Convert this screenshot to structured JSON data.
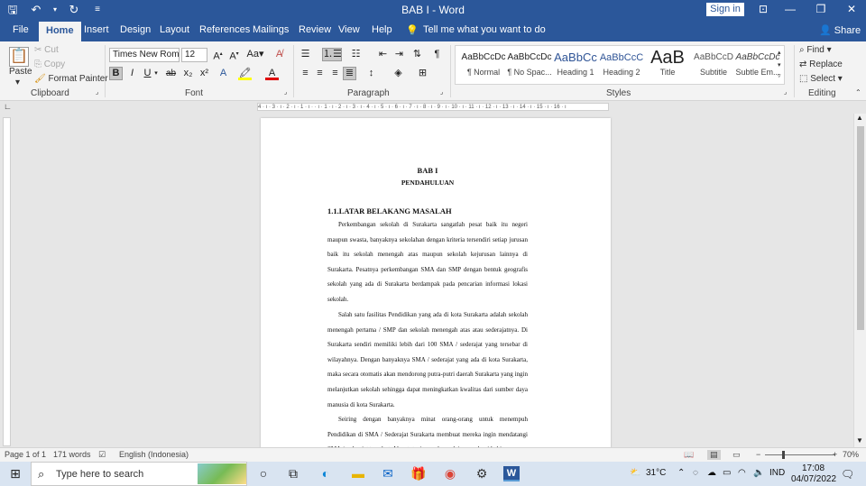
{
  "titlebar": {
    "title": "BAB I  -  Word",
    "sign_in": "Sign in",
    "icons": [
      "save-icon",
      "undo-icon",
      "redo-icon",
      "customize-icon",
      "ribbon-display-icon",
      "minimize-icon",
      "restore-icon",
      "close-icon"
    ],
    "bg_color": "#2b579a"
  },
  "tabs": [
    "File",
    "Home",
    "Insert",
    "Design",
    "Layout",
    "References",
    "Mailings",
    "Review",
    "View",
    "Help",
    "Tell me what you want to do",
    "Share"
  ],
  "clipboard": {
    "paste": "Paste",
    "cut": "Cut",
    "copy": "Copy",
    "format_painter": "Format Painter",
    "label": "Clipboard"
  },
  "font": {
    "name": "Times New Roma",
    "size": "12",
    "label": "Font",
    "bold": "B",
    "italic": "I",
    "underline": "U",
    "strike": "ab",
    "sub": "x₂",
    "sup": "x²"
  },
  "paragraph": {
    "label": "Paragraph"
  },
  "styles": {
    "label": "Styles",
    "items": [
      {
        "preview": "AaBbCcDc",
        "name": "¶ Normal"
      },
      {
        "preview": "AaBbCcDc",
        "name": "¶ No Spac..."
      },
      {
        "preview": "AaBbCc",
        "name": "Heading 1"
      },
      {
        "preview": "AaBbCcC",
        "name": "Heading 2"
      },
      {
        "preview": "AaB",
        "name": "Title"
      },
      {
        "preview": "AaBbCcD",
        "name": "Subtitle"
      },
      {
        "preview": "AaBbCcDc",
        "name": "Subtle Em..."
      }
    ]
  },
  "editing": {
    "find": "Find",
    "replace": "Replace",
    "select": "Select",
    "label": "Editing"
  },
  "ruler": {
    "text": "4 · ı · 3 · ı · 2 · ı · 1 · ı ·   · ı · 1 · ı · 2 · ı · 3 · ı · 4 · ı · 5 · ı · 6 · ı · 7 · ı · 8 · ı · 9 · ı · 10 · ı · 11 · ı · 12 · ı · 13 · ı · 14 · ı · 15 · ı · 16 · ı"
  },
  "document": {
    "title": "BAB I",
    "subtitle": "PENDAHULUAN",
    "section": "1.1.LATAR BELAKANG MASALAH",
    "p1": "Perkembangan sekolah di Surakarta sangatlah pesat baik itu negeri maupun swasta, banyaknya sekolahan dengan kriteria tersendiri setiap jurusan baik itu sekolah menengah atas maupun sekolah kejurusan lainnya di Surakarta. Pesatnya perkembangan SMA dan SMP dengan bentuk geografis sekolah yang ada di Surakarta berdampak pada pencarian informasi lokasi sekolah.",
    "p2": "Salah satu fasilitas Pendidikan yang ada di kota Surakarta adalah sekolah menengah pertama / SMP dan sekolah menengah atas atau sederajatnya. Di Surakarta sendiri memiliki lebih dari 100 SMA / sederajat yang tersebar di wilayahnya. Dengan banyaknya SMA / sederajat yang ada di kota Surakarta, maka secara otomatis akan mendorong putra-putri daerah Surakarta yang ingin melanjutkan sekolah sehingga dapat meningkatkan kwalitas dari sumber daya manusia di kota Surakarta.",
    "p3": "Seiring dengan banyaknya minat orang-orang untuk menempuh Pendidikan di SMA / Sederajat Surakarta membuat mereka ingin mendatangi SMA / sederajat tersebut. Akan tetapi, mereka mulai mengalami kebingungan"
  },
  "status": {
    "page": "Page 1 of 1",
    "words": "171 words",
    "language": "English (Indonesia)",
    "zoom": "70%"
  },
  "taskbar": {
    "search_placeholder": "Type here to search",
    "temperature": "31°C",
    "lang": "IND",
    "time": "17:08",
    "date": "04/07/2022"
  }
}
